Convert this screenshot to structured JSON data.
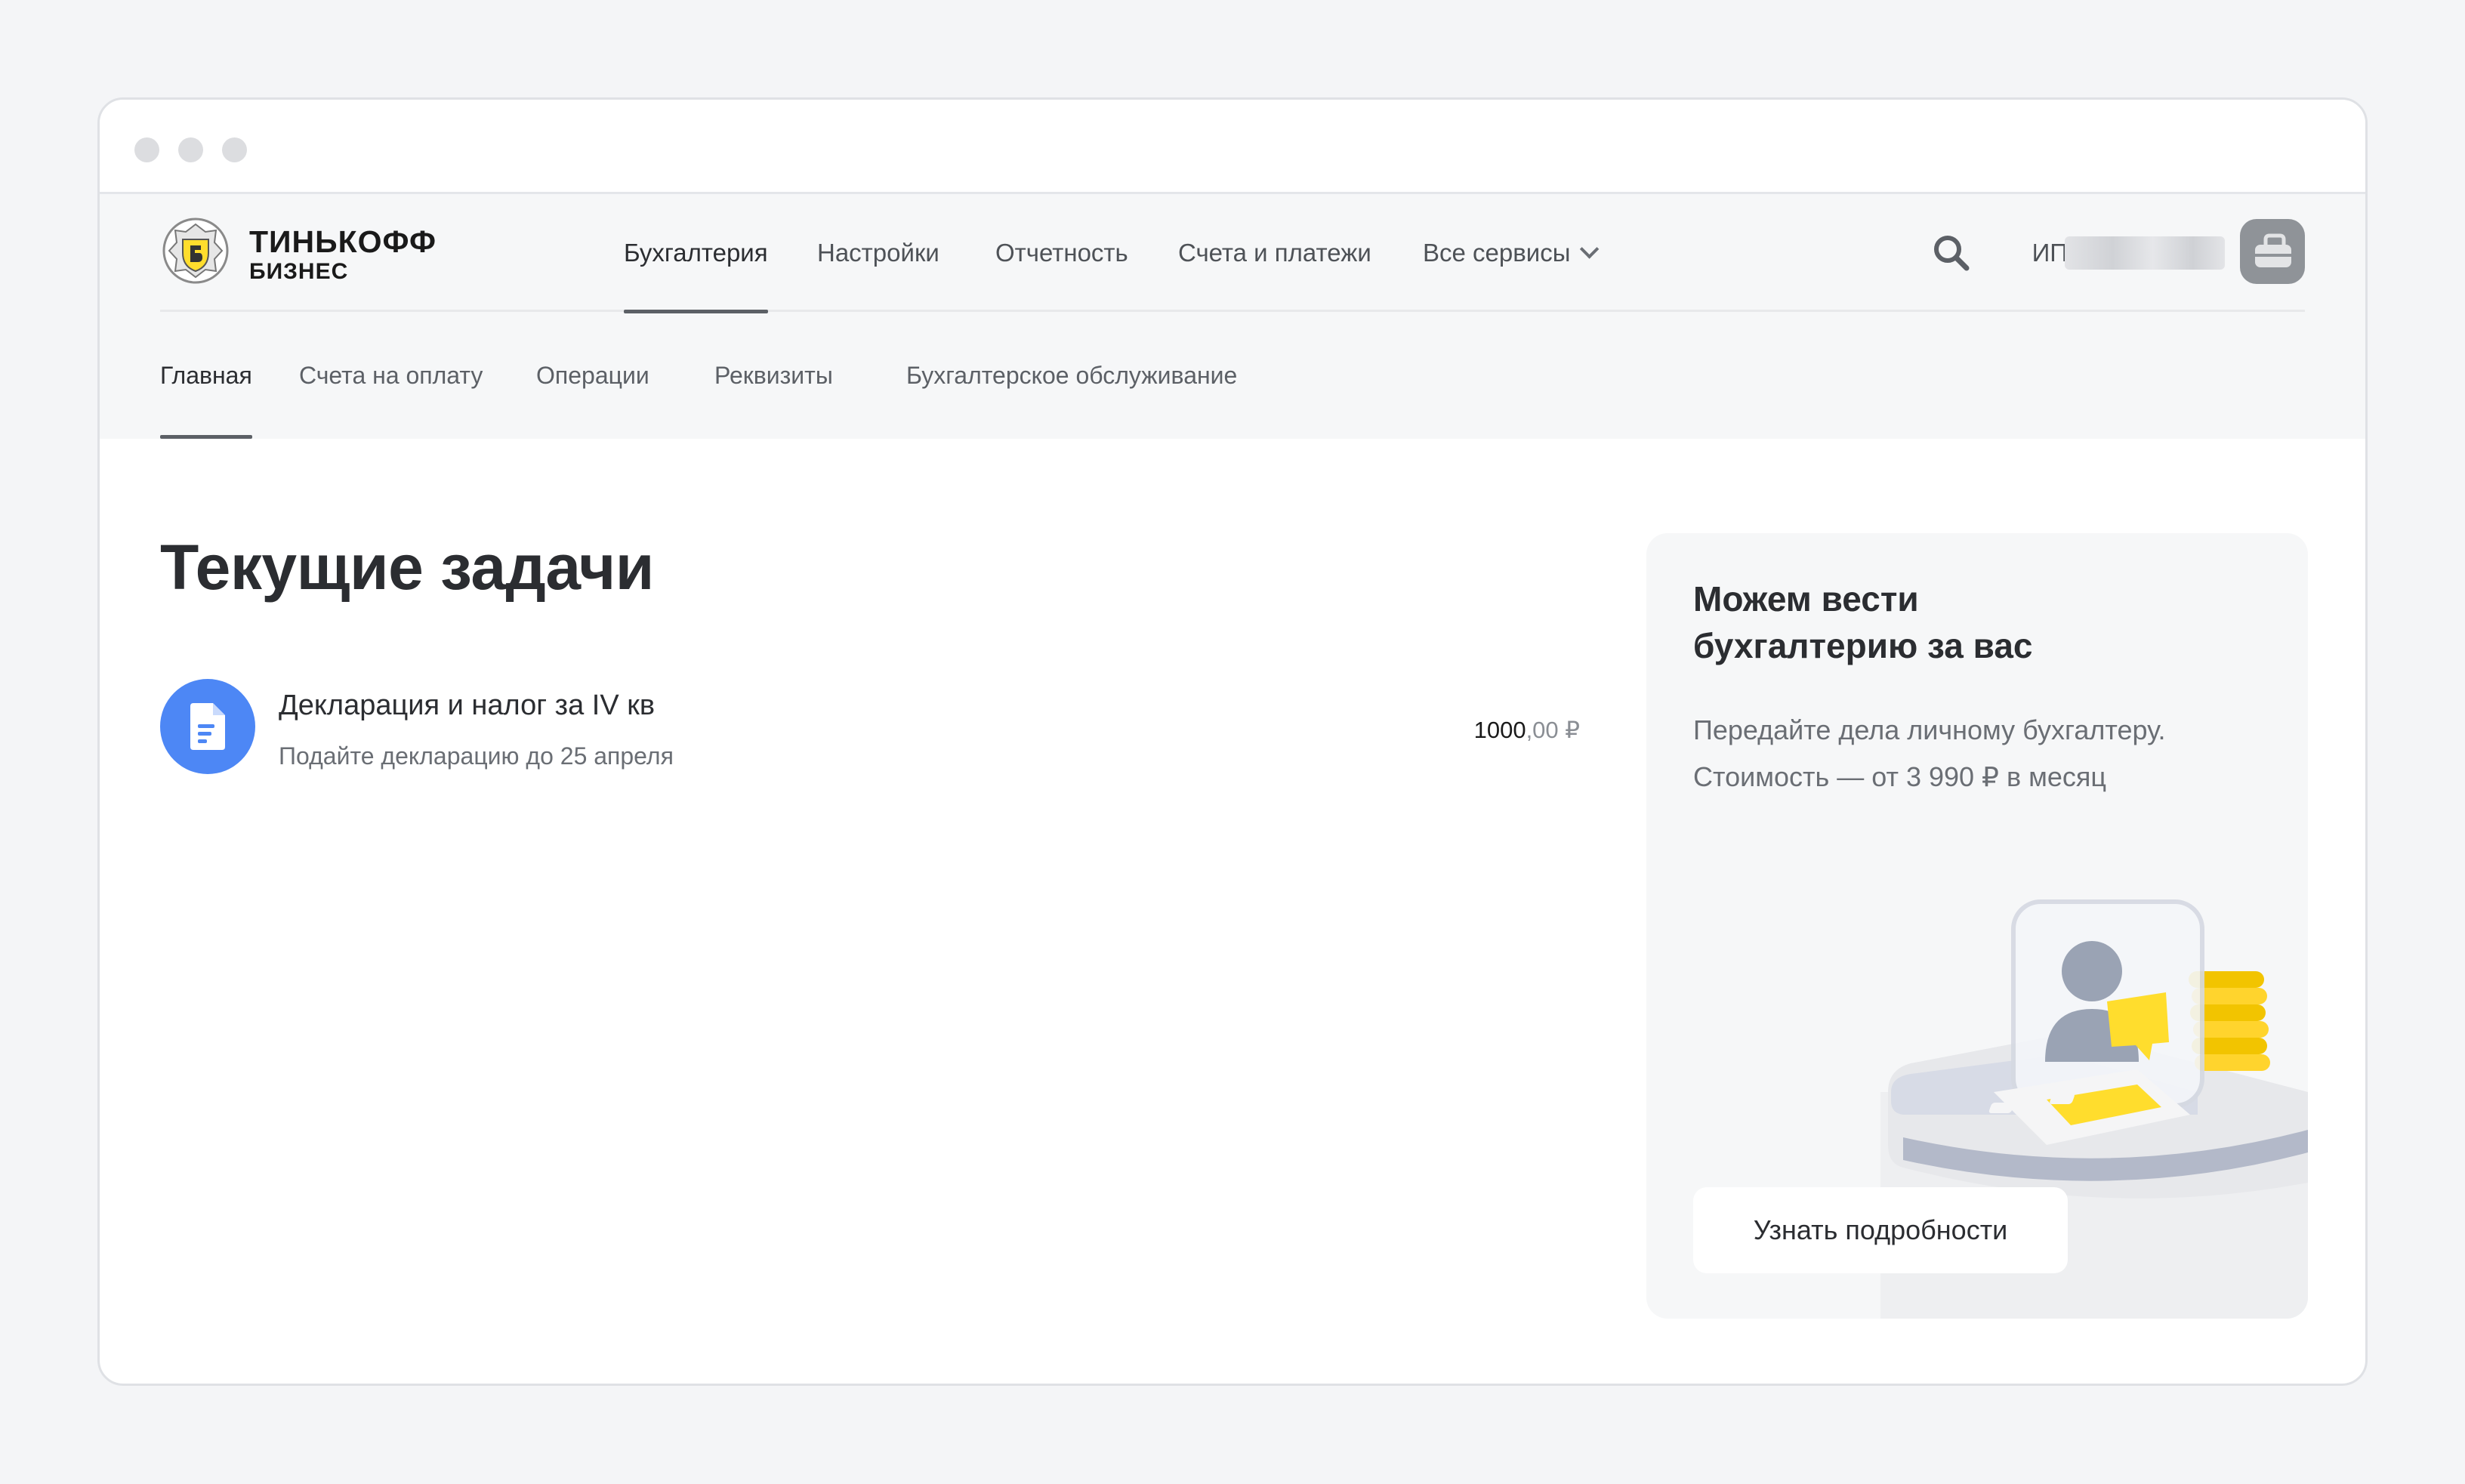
{
  "logo": {
    "line1": "ТИНЬКОФФ",
    "line2": "БИЗНЕС"
  },
  "topnav": {
    "items": [
      {
        "label": "Бухгалтерия",
        "active": true
      },
      {
        "label": "Настройки",
        "active": false
      },
      {
        "label": "Отчетность",
        "active": false
      },
      {
        "label": "Счета и платежи",
        "active": false
      },
      {
        "label": "Все сервисы",
        "active": false,
        "icon": "chevron-down-icon"
      }
    ]
  },
  "user": {
    "prefix": "ИП"
  },
  "subnav": {
    "items": [
      {
        "label": "Главная",
        "active": true
      },
      {
        "label": "Счета на оплату",
        "active": false
      },
      {
        "label": "Операции",
        "active": false
      },
      {
        "label": "Реквизиты",
        "active": false
      },
      {
        "label": "Бухгалтерское обслуживание",
        "active": false
      }
    ]
  },
  "main": {
    "title": "Текущие задачи",
    "tasks": [
      {
        "icon": "document-icon",
        "title": "Декларация и налог за IV кв",
        "subtitle": "Подайте декларацию до 25 апреля",
        "amount_int": "1000",
        "amount_frac": ",00 ₽"
      }
    ]
  },
  "promo": {
    "title": "Можем вести бухгалтерию за вас",
    "text": "Передайте дела личному бухгалтеру. Стоимость — от 3 990 ₽ в месяц",
    "button": "Узнать подробности"
  },
  "colors": {
    "accent_blue": "#4d87f5",
    "brand_yellow": "#ffdd2d",
    "header_bg": "#f6f7f8"
  }
}
